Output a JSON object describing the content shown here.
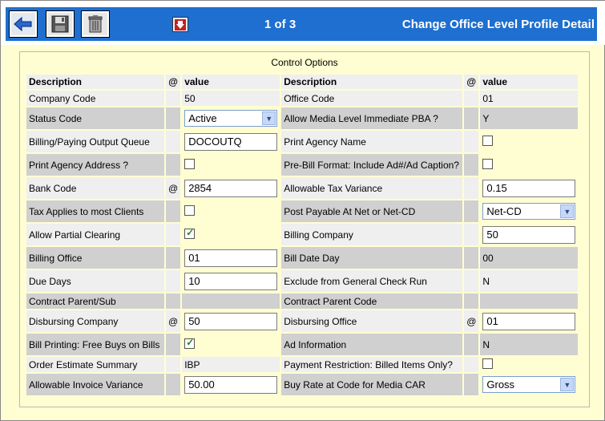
{
  "toolbar": {
    "back_icon": "back-arrow-icon",
    "save_icon": "save-disk-icon",
    "delete_icon": "trash-icon",
    "nav_icon": "down-arrow-icon"
  },
  "header": {
    "pager": "1 of 3",
    "title": "Change Office Level Profile Detail",
    "accent": "#1e6fcf"
  },
  "section": {
    "title": "Control Options"
  },
  "columns": {
    "description": "Description",
    "at": "@",
    "value": "value"
  },
  "rows": [
    {
      "l_label": "Company Code",
      "l_at": "",
      "l_value": "50",
      "r_label": "Office Code",
      "r_at": "",
      "r_value": "01"
    },
    {
      "l_label": "Status Code",
      "l_at": "",
      "l_value": "Active",
      "r_label": "Allow Media Level Immediate PBA ?",
      "r_at": "",
      "r_value": "Y"
    },
    {
      "l_label": "Billing/Paying Output Queue",
      "l_at": "",
      "l_value": "DOCOUTQ",
      "r_label": "Print Agency Name",
      "r_at": "",
      "r_value": ""
    },
    {
      "l_label": "Print Agency Address ?",
      "l_at": "",
      "l_value": "",
      "r_label": "Pre-Bill Format: Include Ad#/Ad Caption?",
      "r_at": "",
      "r_value": ""
    },
    {
      "l_label": "Bank Code",
      "l_at": "@",
      "l_value": "2854",
      "r_label": "Allowable Tax Variance",
      "r_at": "",
      "r_value": "0.15"
    },
    {
      "l_label": "Tax Applies to most Clients",
      "l_at": "",
      "l_value": "",
      "r_label": "Post Payable At Net or Net-CD",
      "r_at": "",
      "r_value": "Net-CD"
    },
    {
      "l_label": "Allow Partial Clearing",
      "l_at": "",
      "l_value": "checked",
      "r_label": "Billing Company",
      "r_at": "",
      "r_value": "50"
    },
    {
      "l_label": "Billing Office",
      "l_at": "",
      "l_value": "01",
      "r_label": "Bill Date Day",
      "r_at": "",
      "r_value": "00"
    },
    {
      "l_label": "Due Days",
      "l_at": "",
      "l_value": "10",
      "r_label": "Exclude from General Check Run",
      "r_at": "",
      "r_value": "N"
    },
    {
      "l_label": "Contract Parent/Sub",
      "l_at": "",
      "l_value": "",
      "r_label": "Contract Parent Code",
      "r_at": "",
      "r_value": ""
    },
    {
      "l_label": "Disbursing Company",
      "l_at": "@",
      "l_value": "50",
      "r_label": "Disbursing Office",
      "r_at": "@",
      "r_value": "01"
    },
    {
      "l_label": "Bill Printing: Free Buys on Bills",
      "l_at": "",
      "l_value": "checked",
      "r_label": "Ad Information",
      "r_at": "",
      "r_value": "N"
    },
    {
      "l_label": "Order Estimate Summary",
      "l_at": "",
      "l_value": "IBP",
      "r_label": "Payment Restriction: Billed Items Only?",
      "r_at": "",
      "r_value": ""
    },
    {
      "l_label": "Allowable Invoice Variance",
      "l_at": "",
      "l_value": "50.00",
      "r_label": "Buy Rate at Code for Media CAR",
      "r_at": "",
      "r_value": "Gross"
    }
  ]
}
